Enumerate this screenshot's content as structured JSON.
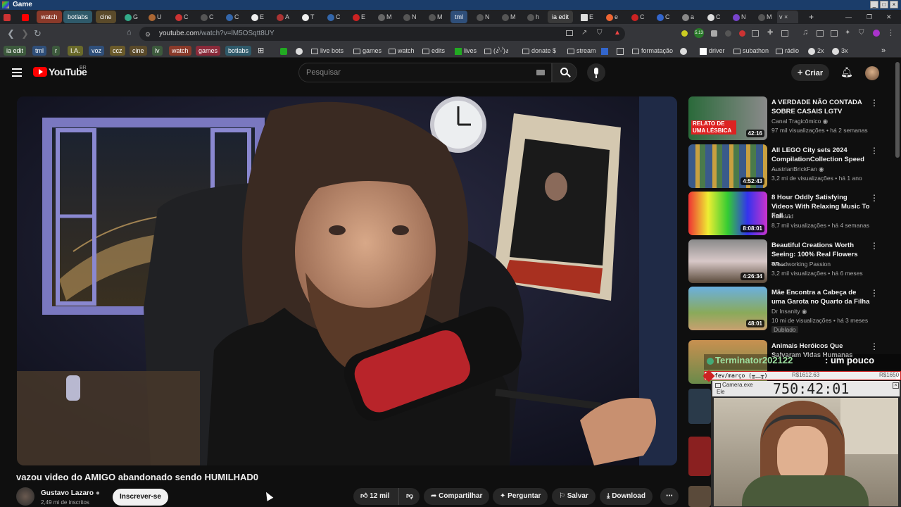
{
  "window": {
    "title": "Game"
  },
  "tabs": [
    {
      "label": "watch",
      "color": "#8a3a2a"
    },
    {
      "label": "botlabs",
      "color": "#2f5a6a"
    },
    {
      "label": "cine",
      "color": "#5a4a2a"
    },
    {
      "label": "G"
    },
    {
      "label": "U"
    },
    {
      "label": "C"
    },
    {
      "label": "C"
    },
    {
      "label": "C"
    },
    {
      "label": "E"
    },
    {
      "label": "A"
    },
    {
      "label": "T"
    },
    {
      "label": "C"
    },
    {
      "label": "E"
    },
    {
      "label": "M"
    },
    {
      "label": "N"
    },
    {
      "label": "M"
    },
    {
      "label": "tml",
      "color": "#2f4f7a"
    },
    {
      "label": "N"
    },
    {
      "label": "M"
    },
    {
      "label": "h"
    },
    {
      "label": "ia edit",
      "color": "#3a3a3a"
    },
    {
      "label": "E"
    },
    {
      "label": "e"
    },
    {
      "label": "C"
    },
    {
      "label": "C"
    },
    {
      "label": "a"
    },
    {
      "label": "C"
    },
    {
      "label": "N"
    },
    {
      "label": "M"
    },
    {
      "label": "v"
    }
  ],
  "address": {
    "domain": "youtube.com",
    "path": "/watch?v=lM5OSqtt8UY"
  },
  "bookmarks": [
    {
      "label": "ia edit",
      "tag": true,
      "color": "#3d5a3d"
    },
    {
      "label": "tml",
      "tag": true,
      "color": "#2f4f7a"
    },
    {
      "label": "r",
      "tag": true,
      "color": "#3d5a3d"
    },
    {
      "label": "I.A.",
      "tag": true,
      "color": "#6a6a2a"
    },
    {
      "label": "voz",
      "tag": true,
      "color": "#2f4f7a"
    },
    {
      "label": "ccz",
      "tag": true,
      "color": "#6a5a2a"
    },
    {
      "label": "cine",
      "tag": true,
      "color": "#5a4a2a"
    },
    {
      "label": "lv",
      "tag": true,
      "color": "#3d5a3d"
    },
    {
      "label": "watch",
      "tag": true,
      "color": "#8a3a2a"
    },
    {
      "label": "games",
      "tag": true,
      "color": "#8a2a3a"
    },
    {
      "label": "botlabs",
      "tag": true,
      "color": "#2f5a6a"
    },
    {
      "label": "live bots"
    },
    {
      "label": "games"
    },
    {
      "label": "watch"
    },
    {
      "label": "edits"
    },
    {
      "label": "lives"
    },
    {
      "label": "(ง'̀-'́)ง"
    },
    {
      "label": "donate $"
    },
    {
      "label": "stream"
    },
    {
      "label": "formatação"
    },
    {
      "label": "driver"
    },
    {
      "label": "subathon"
    },
    {
      "label": "rádio"
    },
    {
      "label": "2x"
    },
    {
      "label": "3x"
    }
  ],
  "youtube": {
    "logo": "YouTube",
    "region": "BR",
    "search_placeholder": "Pesquisar",
    "create_label": "Criar"
  },
  "video": {
    "title": "vazou video do AMIGO abandonado sendo HUMILHAD0",
    "channel": "Gustavo Lazaro",
    "subscribers": "2,49 mi de inscritos",
    "subscribe_label": "Inscrever-se",
    "likes": "12 mil",
    "share_label": "Compartilhar",
    "ask_label": "Perguntar",
    "save_label": "Salvar",
    "download_label": "Download"
  },
  "recommendations": [
    {
      "title": "A VERDADE NÃO CONTADA SOBRE CASAIS LGTV",
      "channel": "Canal Tragicômico",
      "verified": true,
      "stats": "97 mil visualizações • há 2 semanas",
      "duration": "42:16",
      "thumb_text": "RELATO DE UMA LÉSBICA"
    },
    {
      "title": "All LEGO City sets 2024 CompilationCollection Speed ...",
      "channel": "AustrianBrickFan",
      "verified": true,
      "stats": "3,2 mi de visualizações • há 1 ano",
      "duration": "4:52:43"
    },
    {
      "title": "8 Hour Oddly Satisfying Videos With Relaxing Music To Fall ...",
      "channel": "SatisVid",
      "verified": false,
      "stats": "8,7 mil visualizações • há 4 semanas",
      "duration": "8:08:01"
    },
    {
      "title": "Beautiful Creations Worth Seeing: 100% Real Flowers an...",
      "channel": "Woodworking Passion",
      "verified": false,
      "stats": "3,2 mil visualizações • há 6 meses",
      "duration": "4:26:34"
    },
    {
      "title": "Mãe Encontra a Cabeça de uma Garota no Quarto da Filha",
      "channel": "Dr Insanity",
      "verified": true,
      "stats": "10 mi de visualizações • há 3 meses",
      "duration": "48:01",
      "badge": "Dublado"
    },
    {
      "title": "Animais Heróicos Que Salvaram Vidas Humanas",
      "channel": "",
      "stats": "",
      "duration": ""
    }
  ],
  "overlay": {
    "chat_user": "Terminator202122",
    "chat_message": ": um pouco",
    "goal_label": "fev/março (╥﹏╥)",
    "goal_current": "R$1612.63",
    "goal_target": "R$1650",
    "window_title": "Camera.exe",
    "window_sub": "Ele",
    "timer": "750:42:01"
  },
  "colors": {
    "youtube_red": "#ff0000",
    "bg": "#0f0f0f"
  }
}
